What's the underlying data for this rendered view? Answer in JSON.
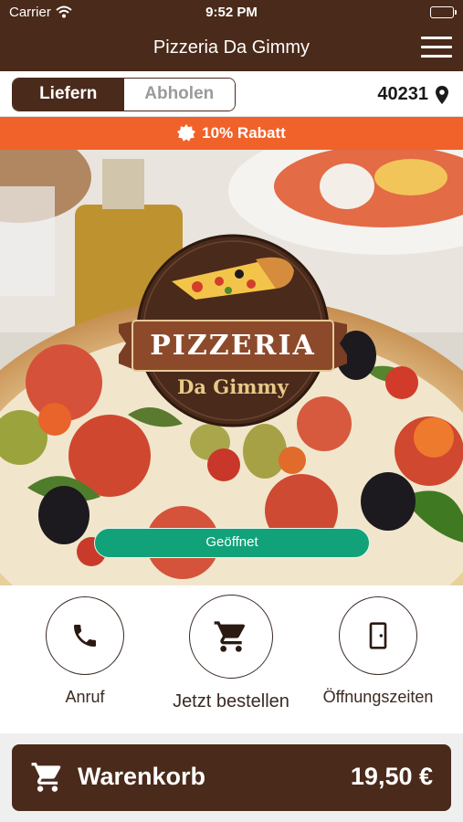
{
  "status_bar": {
    "carrier": "Carrier",
    "time": "9:52 PM"
  },
  "header": {
    "title": "Pizzeria Da Gimmy",
    "menu_icon": "hamburger-menu-icon"
  },
  "mode_toggle": {
    "options": [
      "Liefern",
      "Abholen"
    ],
    "selected": "Liefern"
  },
  "location": {
    "postal_code": "40231",
    "icon": "map-pin-icon"
  },
  "discount": {
    "text": "10% Rabatt",
    "icon": "badge-icon"
  },
  "hero": {
    "logo": {
      "name": "PIZZERIA",
      "sub": "Da Gimmy"
    },
    "status_badge": "Geöffnet"
  },
  "actions": [
    {
      "label": "Anruf",
      "icon": "phone-icon"
    },
    {
      "label": "Jetzt bestellen",
      "icon": "cart-icon"
    },
    {
      "label": "Öffnungszeiten",
      "icon": "door-icon"
    }
  ],
  "cart": {
    "label": "Warenkorb",
    "total": "19,50 €",
    "icon": "cart-icon"
  },
  "colors": {
    "brand_brown": "#4a2a1a",
    "discount_orange": "#f0622a",
    "open_green": "#12a27a"
  }
}
